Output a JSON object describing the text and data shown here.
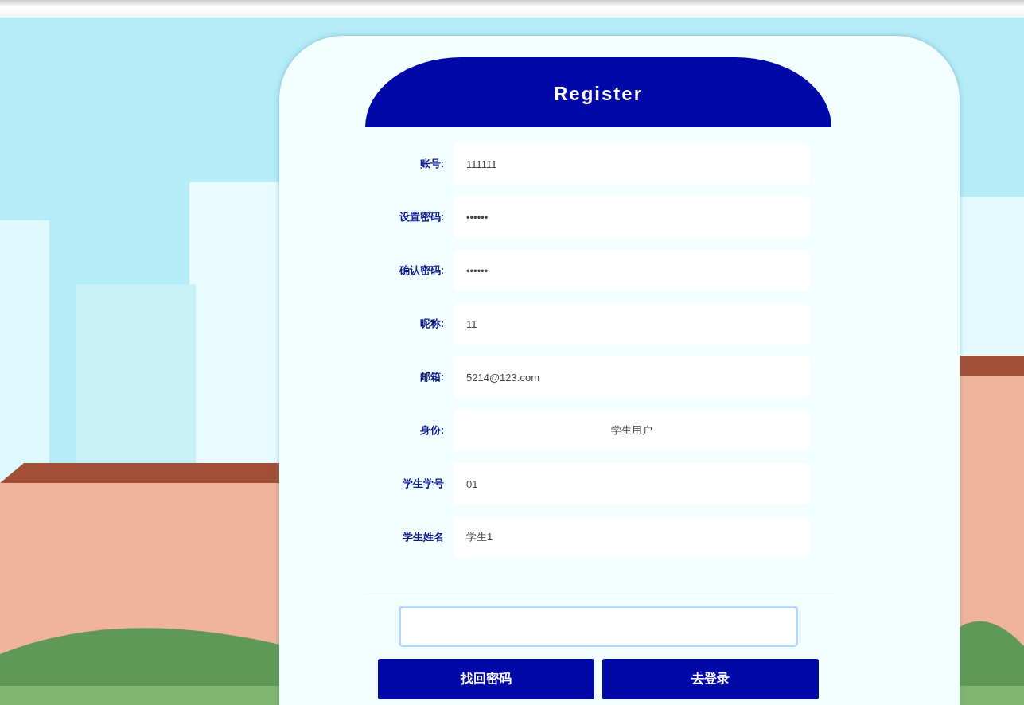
{
  "title": "Register",
  "fields": [
    {
      "label": "账号:",
      "kind": "input",
      "value": "111111"
    },
    {
      "label": "设置密码:",
      "kind": "input",
      "value": "••••••"
    },
    {
      "label": "确认密码:",
      "kind": "input",
      "value": "••••••"
    },
    {
      "label": "昵称:",
      "kind": "input",
      "value": "11"
    },
    {
      "label": "邮箱:",
      "kind": "input",
      "value": "5214@123.com"
    },
    {
      "label": "身份:",
      "kind": "select",
      "value": "学生用户"
    },
    {
      "label": "学生学号",
      "kind": "input",
      "value": "01"
    },
    {
      "label": "学生姓名",
      "kind": "input",
      "value": "学生1"
    }
  ],
  "text_area": {
    "focused": true
  },
  "buttons": [
    "找回密码",
    "去登录"
  ]
}
